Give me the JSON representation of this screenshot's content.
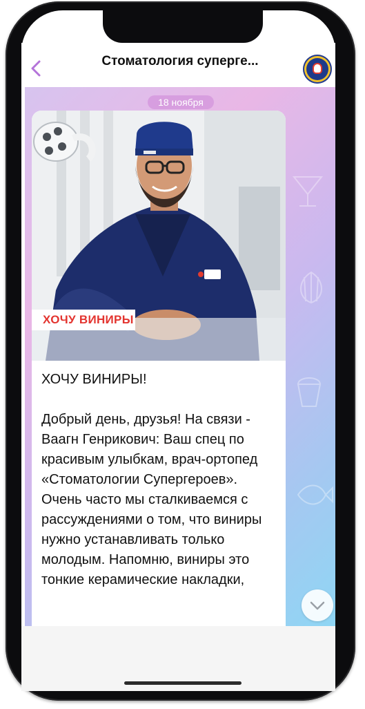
{
  "header": {
    "back_icon": "chevron-left-icon",
    "title": "Стоматология суперге...",
    "avatar_icon": "superhero-dental-logo",
    "accent_color": "#b473d9"
  },
  "chat": {
    "date_badge": "18 ноября",
    "post": {
      "image_caption": "ХОЧУ ВИНИРЫ",
      "heading": "ХОЧУ ВИНИРЫ!",
      "body": "Добрый день, друзья! На связи - Ваагн Генрикович: Ваш спец по красивым улыбкам, врач-ортопед «Стоматологии Супергероев».\nОчень часто мы сталкиваемся с рассуждениями о том, что виниры нужно устанавливать только молодым. Напомню, виниры это тонкие керамические накладки,"
    }
  },
  "scroll_button": {
    "icon": "chevron-down-icon"
  }
}
